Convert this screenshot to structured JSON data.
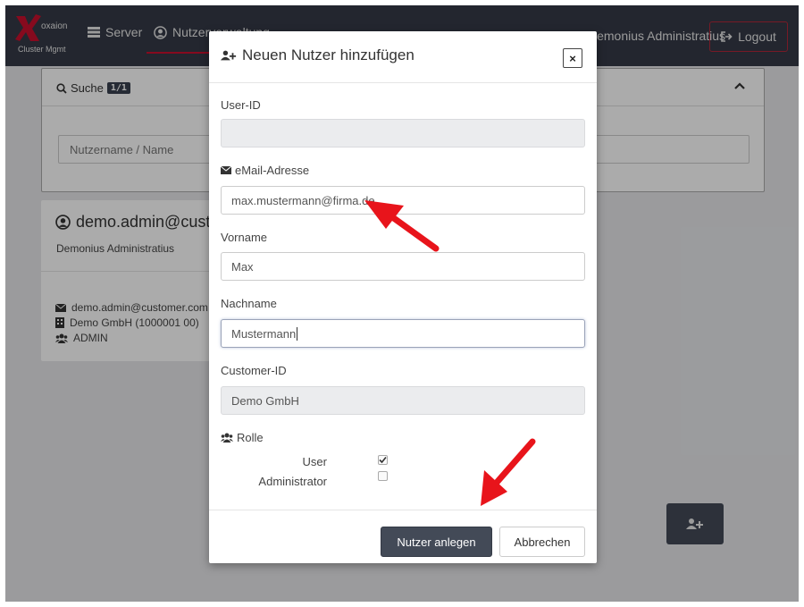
{
  "brand": {
    "name": "oxaion",
    "subtitle": "Cluster Mgmt"
  },
  "navbar": {
    "server_label": "Server",
    "users_label": "Nutzerverwaltung",
    "current_user": "Demonius Administratius",
    "logout_label": "Logout"
  },
  "search": {
    "title": "Suche",
    "count": "1/1",
    "placeholder": "Nutzername / Name"
  },
  "user_card": {
    "user_id": "demo.admin@customer.com",
    "full_name": "Demonius Administratius",
    "email": "demo.admin@customer.com",
    "company": "Demo GmbH (1000001 00)",
    "role": "ADMIN"
  },
  "modal": {
    "title": "Neuen Nutzer hinzufügen",
    "close_label": "×",
    "fields": {
      "user_id_label": "User-ID",
      "user_id_value": "",
      "email_label": "eMail-Adresse",
      "email_value": "max.mustermann@firma.de",
      "firstname_label": "Vorname",
      "firstname_value": "Max",
      "lastname_label": "Nachname",
      "lastname_value": "Mustermann",
      "customer_label": "Customer-ID",
      "customer_value": "Demo GmbH"
    },
    "roles": {
      "label": "Rolle",
      "items": [
        {
          "label": "User",
          "checked": true
        },
        {
          "label": "Administrator",
          "checked": false
        }
      ]
    },
    "submit_label": "Nutzer anlegen",
    "cancel_label": "Abbrechen"
  },
  "colors": {
    "navbar": "#353a46",
    "accent": "#c8102e",
    "primary_button": "#434a57",
    "annotation_arrow": "#e8141b"
  }
}
